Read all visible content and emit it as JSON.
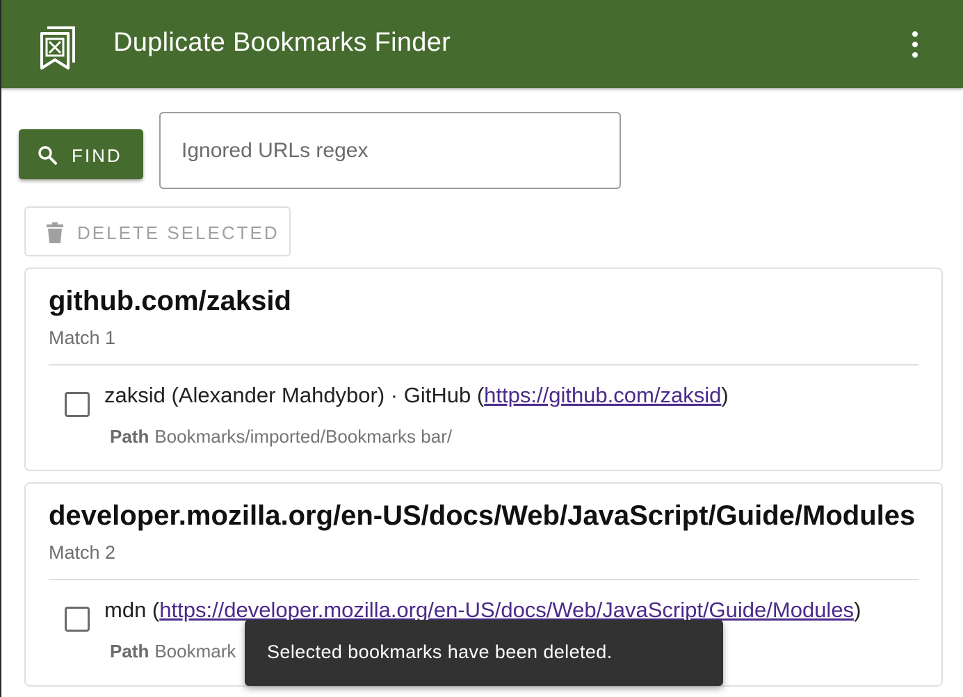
{
  "app": {
    "title": "Duplicate Bookmarks Finder",
    "logo_icon": "bookmark-x-icon",
    "menu_icon": "more-vertical-icon",
    "brand_color": "#466b2e"
  },
  "toolbar": {
    "find_label": "FIND",
    "find_icon": "search-icon",
    "regex_placeholder": "Ignored URLs regex",
    "regex_value": "",
    "delete_label": "DELETE SELECTED",
    "delete_icon": "trash-icon"
  },
  "matches": [
    {
      "heading": "github.com/zaksid",
      "subtitle": "Match 1",
      "bookmark": {
        "title": "zaksid (Alexander Mahdybor) · GitHub",
        "url": "https://github.com/zaksid",
        "path_label": "Path",
        "path": "Bookmarks/imported/Bookmarks bar/",
        "checked": false
      }
    },
    {
      "heading": "developer.mozilla.org/en-US/docs/Web/JavaScript/Guide/Modules",
      "subtitle": "Match 2",
      "bookmark": {
        "title": "mdn",
        "url": "https://developer.mozilla.org/en-US/docs/Web/JavaScript/Guide/Modules",
        "path_label": "Path",
        "path": "Bookmark",
        "checked": false
      }
    }
  ],
  "snackbar": {
    "message": "Selected bookmarks have been deleted."
  }
}
